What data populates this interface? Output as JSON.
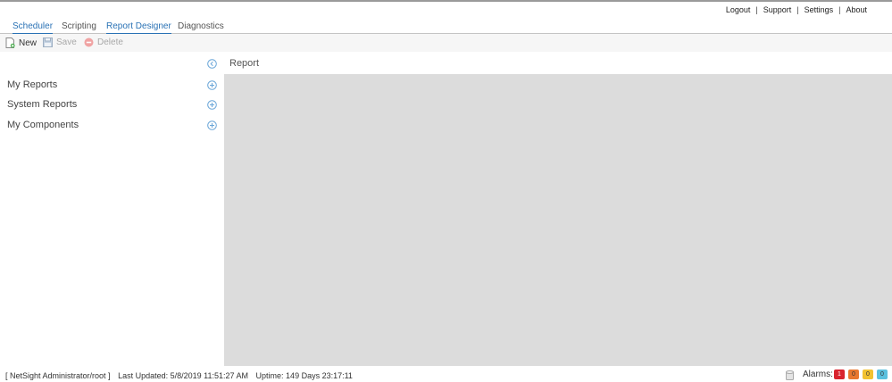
{
  "header": {
    "links": [
      "Logout",
      "Support",
      "Settings",
      "About"
    ]
  },
  "tabs": [
    {
      "label": "Scheduler",
      "active": true
    },
    {
      "label": "Scripting",
      "active": false
    },
    {
      "label": "Report Designer",
      "active": true
    },
    {
      "label": "Diagnostics",
      "active": false
    }
  ],
  "toolbar": {
    "new_label": "New",
    "save_label": "Save",
    "delete_label": "Delete"
  },
  "sidebar": {
    "items": [
      {
        "label": "My Reports"
      },
      {
        "label": "System Reports"
      },
      {
        "label": "My Components"
      }
    ]
  },
  "main": {
    "title": "Report"
  },
  "status": {
    "user": "[ NetSight Administrator/root ]",
    "last_updated": "Last Updated: 5/8/2019 11:51:27 AM",
    "uptime": "Uptime: 149 Days 23:17:11",
    "alarms_label": "Alarms:",
    "alarms": [
      {
        "count": "1",
        "color": "#d9232e"
      },
      {
        "count": "0",
        "color": "#e8772e"
      },
      {
        "count": "0",
        "color": "#f2c230"
      },
      {
        "count": "0",
        "color": "#5bc0de"
      }
    ]
  },
  "colors": {
    "accent": "#2a72b5",
    "canvas": "#dcdcdc"
  }
}
